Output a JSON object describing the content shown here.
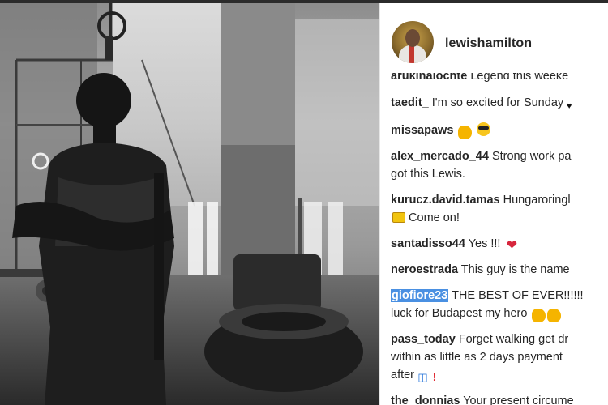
{
  "post": {
    "username": "lewishamilton"
  },
  "comments": [
    {
      "user": "arukinalocnte",
      "text": "Legend this weeke"
    },
    {
      "user": "taedit_",
      "text": "I'm so excited for Sunday"
    },
    {
      "user": "missapaws",
      "text": ""
    },
    {
      "user": "alex_mercado_44",
      "text": "Strong work pa",
      "text2": "got this Lewis."
    },
    {
      "user": "kurucz.david.tamas",
      "text": "Hungaroringl",
      "text2": "Come on!"
    },
    {
      "user": "santadisso44",
      "text": "Yes !!!"
    },
    {
      "user": "neroestrada",
      "text": "This guy is the name"
    },
    {
      "user": "giofiore23",
      "text": "THE BEST OF EVER!!!!!!",
      "text2": "luck for Budapest my hero"
    },
    {
      "user": "pass_today",
      "text": "Forget walking get dr",
      "text2": "within as little as 2 days payment",
      "text3": "after"
    },
    {
      "user": "the_donnias",
      "text": "Your present circume"
    }
  ],
  "colors": {
    "text": "#262626",
    "selection": "#4a90e2",
    "heart": "#d7263d"
  },
  "icons": {
    "muscle": "flexed-biceps-emoji",
    "sunglasses": "sunglasses-face-emoji",
    "heart": "red-heart-emoji",
    "flag": "hungary-flag-emoji",
    "car": "car-emoji",
    "exclamation": "red-exclamation-emoji"
  }
}
